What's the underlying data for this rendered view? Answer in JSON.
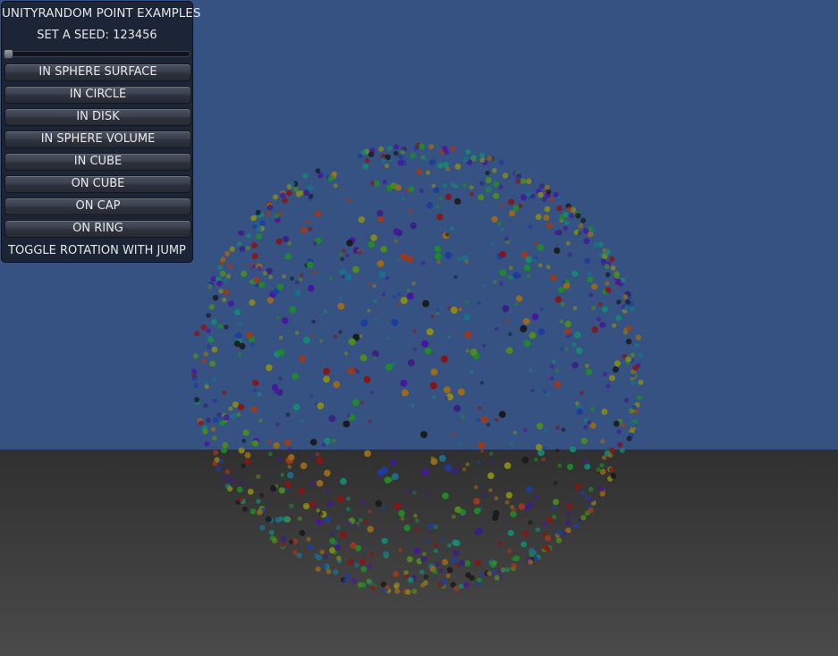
{
  "panel": {
    "title": "UNITYRANDOM POINT EXAMPLES",
    "seed_label": "SET A SEED: 123456",
    "seed_slider_value": 0,
    "buttons": [
      "IN SPHERE SURFACE",
      "IN CIRCLE",
      "IN DISK",
      "IN SPHERE VOLUME",
      "IN CUBE",
      "ON CUBE",
      "ON CAP",
      "ON RING"
    ],
    "footer": "TOGGLE ROTATION WITH JUMP"
  },
  "scene": {
    "sky_color": "#355282",
    "ground_top_color": "#303030",
    "ground_bottom_color": "#4a4a4a",
    "point_colors": [
      "#1a1a1a",
      "#3a2080",
      "#4a14a0",
      "#1e3c9c",
      "#1a6e8c",
      "#138a72",
      "#1e8a28",
      "#4e8c1c",
      "#8a8a18",
      "#9a6a18",
      "#a03818",
      "#8a1414"
    ]
  }
}
